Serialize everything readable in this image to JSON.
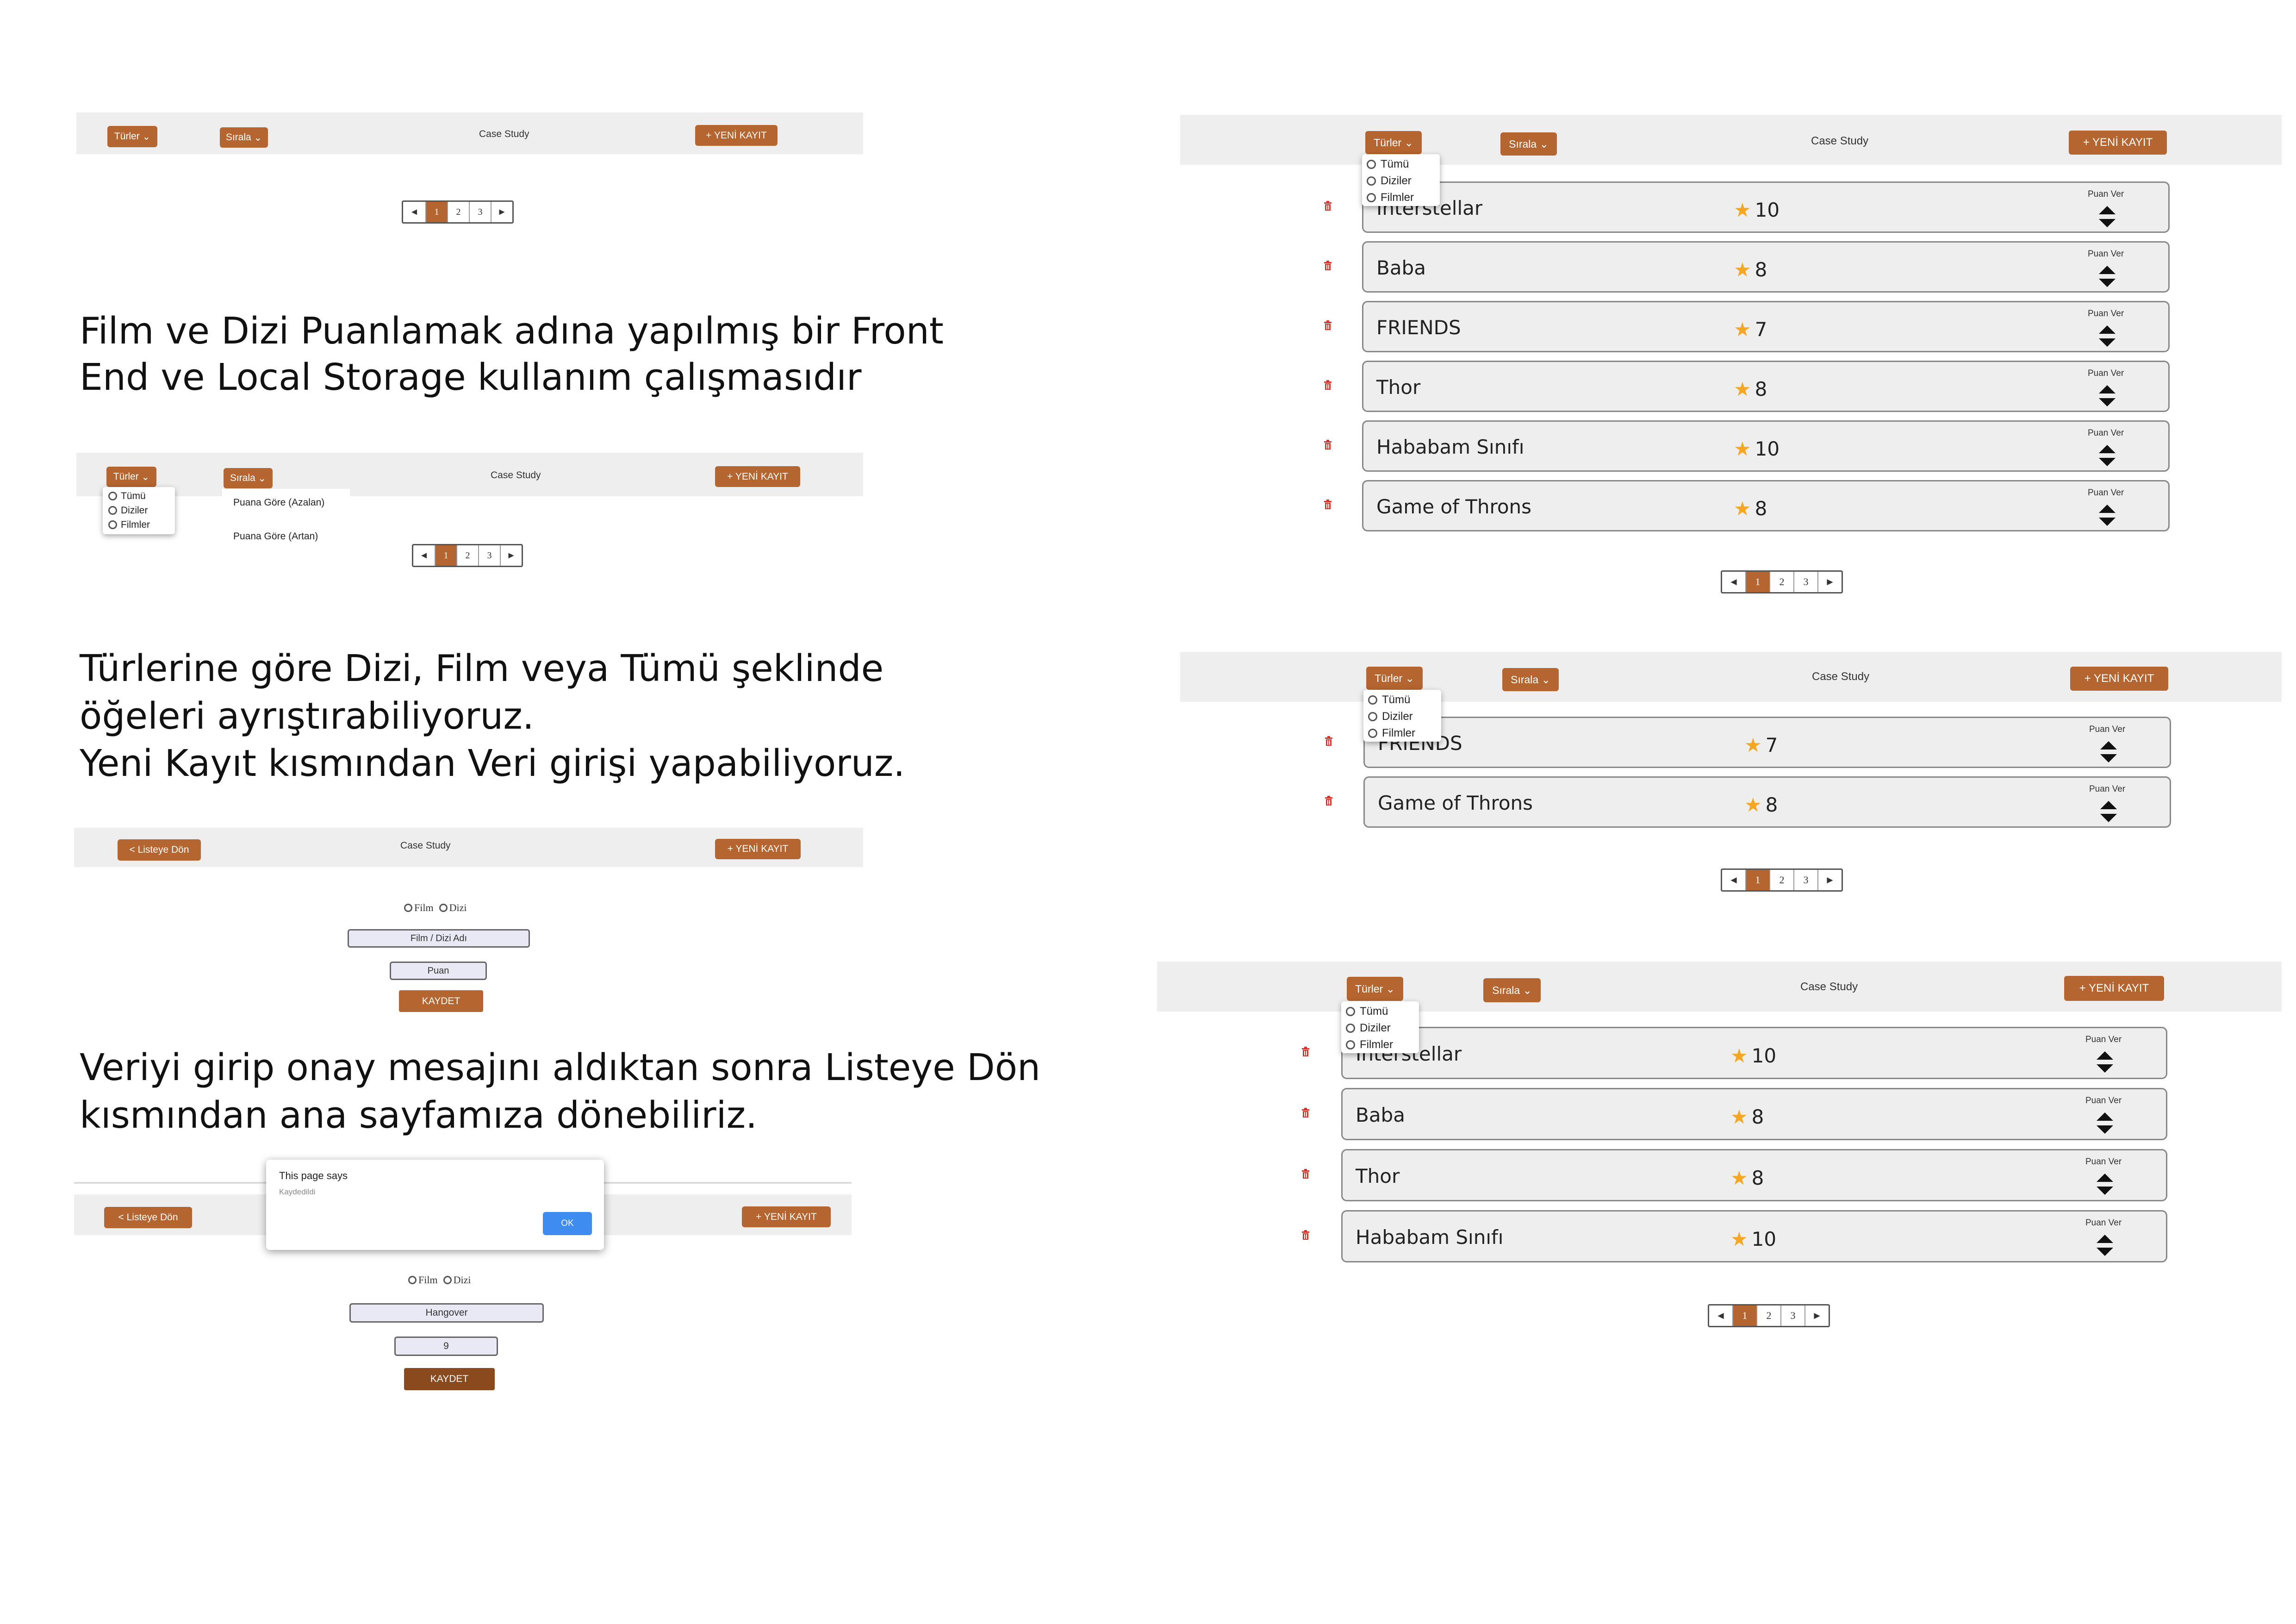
{
  "common": {
    "turler_label": "Türler",
    "sirala_label": "Sırala",
    "app_title": "Case Study",
    "new_record_label": "+  YENİ KAYIT",
    "back_label": "< Listeye Dön",
    "rate_label": "Puan Ver",
    "pages": [
      "1",
      "2",
      "3"
    ],
    "prev_arrow": "◄",
    "next_arrow": "►",
    "accent_color": "#b5652f"
  },
  "filter_options": [
    "Tümü",
    "Diziler",
    "Filmler"
  ],
  "sort_options": [
    "Puana Göre (Azalan)",
    "Puana Göre (Artan)"
  ],
  "descriptions": {
    "d1_line1": "Film ve Dizi Puanlamak adına yapılmış bir Front",
    "d1_line2": "End ve Local Storage kullanım  çalışmasıdır",
    "d2_line1": "Türlerine göre Dizi, Film veya Tümü şeklinde",
    "d2_line2": "öğeleri ayrıştırabiliyoruz.",
    "d2_line3": "Yeni Kayıt kısmından Veri girişi yapabiliyoruz.",
    "d3_line1": "Veriyi girip onay mesajını aldıktan sonra Listeye Dön",
    "d3_line2": "kısmından ana sayfamıza dönebiliriz."
  },
  "form": {
    "film_label": "Film",
    "dizi_label": "Dizi",
    "name_placeholder": "Film / Dizi Adı",
    "score_placeholder": "Puan",
    "save_label": "KAYDET",
    "filled_name": "Hangover",
    "filled_score": "9"
  },
  "alert": {
    "title": "This page says",
    "message": "Kaydedildi",
    "ok_label": "OK"
  },
  "list_all": [
    {
      "name": "Interstellar",
      "score": "10"
    },
    {
      "name": "Baba",
      "score": "8"
    },
    {
      "name": "FRIENDS",
      "score": "7"
    },
    {
      "name": "Thor",
      "score": "8"
    },
    {
      "name": "Hababam Sınıfı",
      "score": "10"
    },
    {
      "name": "Game of Throns",
      "score": "8"
    }
  ],
  "list_series": [
    {
      "name": "FRIENDS",
      "score": "7"
    },
    {
      "name": "Game of Throns",
      "score": "8"
    }
  ],
  "list_films": [
    {
      "name": "Interstellar",
      "score": "10"
    },
    {
      "name": "Baba",
      "score": "8"
    },
    {
      "name": "Thor",
      "score": "8"
    },
    {
      "name": "Hababam Sınıfı",
      "score": "10"
    }
  ]
}
